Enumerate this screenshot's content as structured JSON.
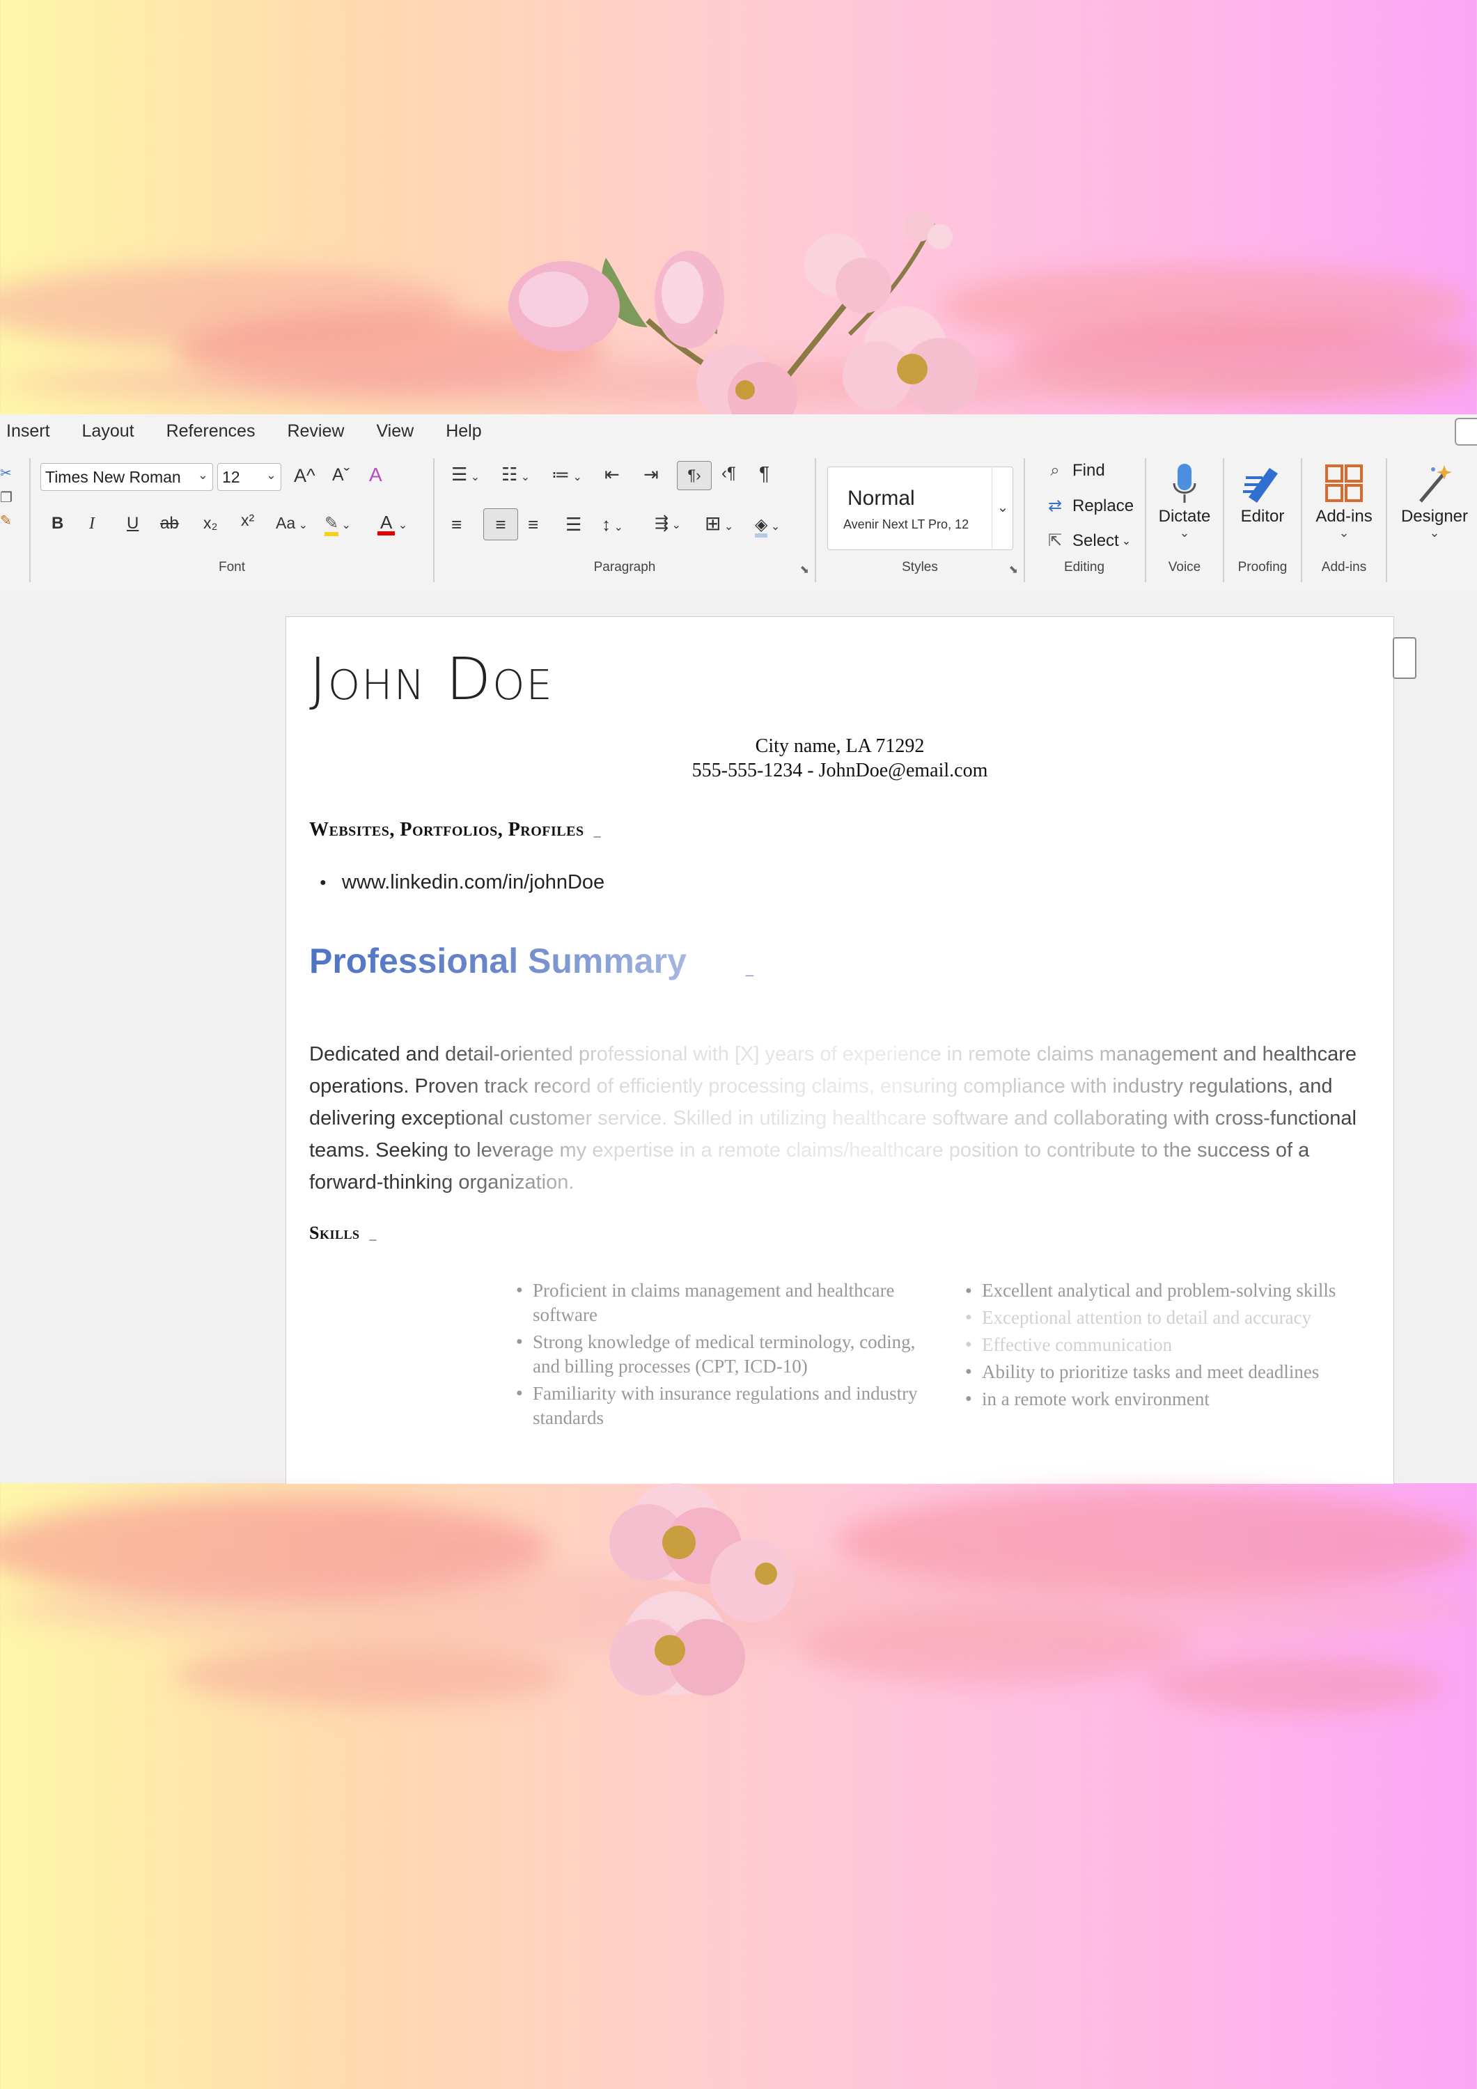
{
  "ribbon": {
    "tabs": [
      "Insert",
      "Layout",
      "References",
      "Review",
      "View",
      "Help"
    ],
    "font": {
      "family": "Times New Roman",
      "size": "12",
      "label": "Font",
      "buttons": {
        "grow": "A^",
        "shrink": "Aˇ",
        "bold": "B",
        "italic": "I",
        "underline": "U",
        "strike": "ab",
        "subscript": "x₂",
        "superscript": "x²",
        "case": "Aa"
      }
    },
    "paragraph": {
      "label": "Paragraph"
    },
    "styles": {
      "current": "Normal",
      "font_desc": "Avenir Next LT Pro, 12",
      "label": "Styles"
    },
    "editing": {
      "find": "Find",
      "replace": "Replace",
      "select": "Select",
      "label": "Editing"
    },
    "voice": {
      "dictate": "Dictate",
      "label": "Voice"
    },
    "proofing": {
      "editor": "Editor",
      "label": "Proofing"
    },
    "addins": {
      "button": "Add-ins",
      "label": "Add-ins"
    },
    "designer": {
      "button": "Designer"
    }
  },
  "document": {
    "name": "John Doe",
    "address": "City name, LA 71292",
    "contact": "555-555-1234 - JohnDoe@email.com",
    "websites_heading": "Websites, Portfolios, Profiles",
    "link": "www.linkedin.com/in/johnDoe",
    "summary_heading": "Professional Summary",
    "summary": "Dedicated and detail-oriented professional with [X] years of experience in remote claims management and healthcare operations. Proven track record of efficiently processing claims, ensuring compliance with industry regulations, and delivering exceptional customer service. Skilled in utilizing healthcare software and collaborating with cross-functional teams. Seeking to leverage my expertise in a remote claims/healthcare position to contribute to the success of a forward-thinking organization.",
    "skills_heading": "Skills",
    "skills": [
      "Proficient in claims management and healthcare software",
      "Strong knowledge of medical terminology, coding, and billing processes (CPT, ICD-10)",
      "Familiarity with insurance regulations and industry standards",
      "Excellent analytical and problem-solving skills",
      "Exceptional attention to detail and accuracy",
      "Effective communication",
      "Ability to prioritize tasks and meet deadlines",
      "in a remote work environment"
    ]
  },
  "colors": {
    "heading_blue": "#4d74c4",
    "highlight_yellow": "#f3d21b",
    "font_red": "#e00000",
    "accent_orange": "#d86a2e"
  }
}
